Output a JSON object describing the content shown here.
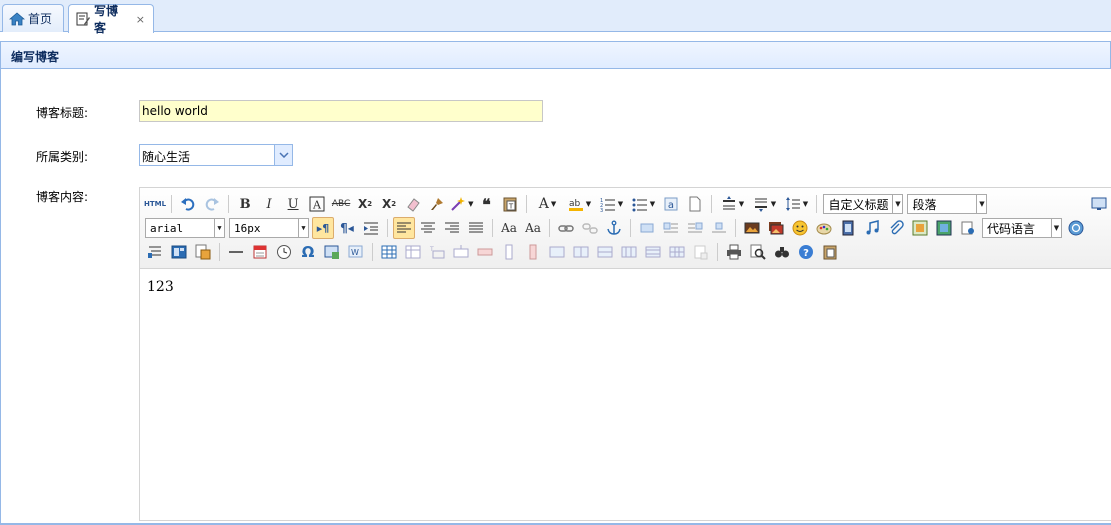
{
  "tabs": [
    {
      "label": "首页",
      "icon": "home-icon"
    },
    {
      "label": "写博客",
      "icon": "edit-icon",
      "close": "×"
    }
  ],
  "panel": {
    "title": "编写博客"
  },
  "form": {
    "title_label": "博客标题:",
    "title_value": "hello world",
    "category_label": "所属类别:",
    "category_value": "随心生活",
    "content_label": "博客内容:"
  },
  "editor": {
    "html_button": "HTML",
    "font_family": "arial",
    "font_size": "16px",
    "heading_select": "自定义标题",
    "paragraph_select": "段落",
    "code_language_select": "代码语言",
    "content": "123"
  },
  "colors": {
    "accent_border": "#95b8e7",
    "tab_bg": "#e1ecfb",
    "title_input_bg": "#ffffcc"
  }
}
